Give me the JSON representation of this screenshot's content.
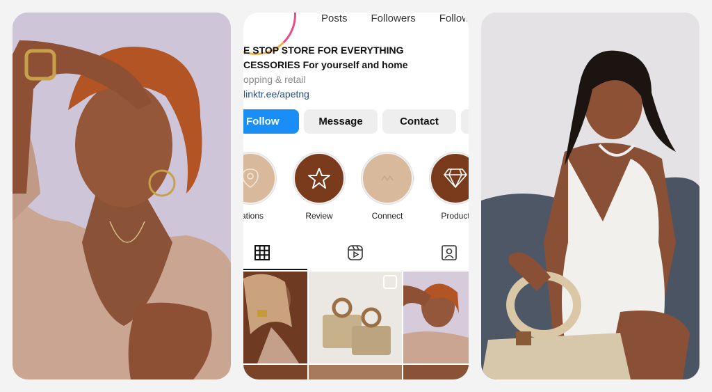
{
  "profile": {
    "stats": {
      "posts_label": "Posts",
      "followers_label": "Followers",
      "following_label": "Follow…"
    },
    "bio": {
      "line1": "E STOP STORE FOR EVERYTHING",
      "line2": "CESSORIES For yourself and home",
      "category": "opping & retail",
      "link": "linktr.ee/apetng"
    },
    "buttons": {
      "follow": "Follow",
      "message": "Message",
      "contact": "Contact"
    },
    "highlights": [
      {
        "label": "cations",
        "icon": "location-pin-icon"
      },
      {
        "label": "Review",
        "icon": "star-icon"
      },
      {
        "label": "Connect",
        "icon": "connect-icon"
      },
      {
        "label": "Product",
        "icon": "diamond-icon"
      }
    ],
    "tabs": [
      "grid-icon",
      "reels-icon",
      "tagged-icon"
    ]
  },
  "colors": {
    "follow_blue": "#1a8ef7",
    "highlight_brown": "#7a3a1c",
    "highlight_beige": "#d9b99b",
    "link_blue": "#234f8c"
  }
}
